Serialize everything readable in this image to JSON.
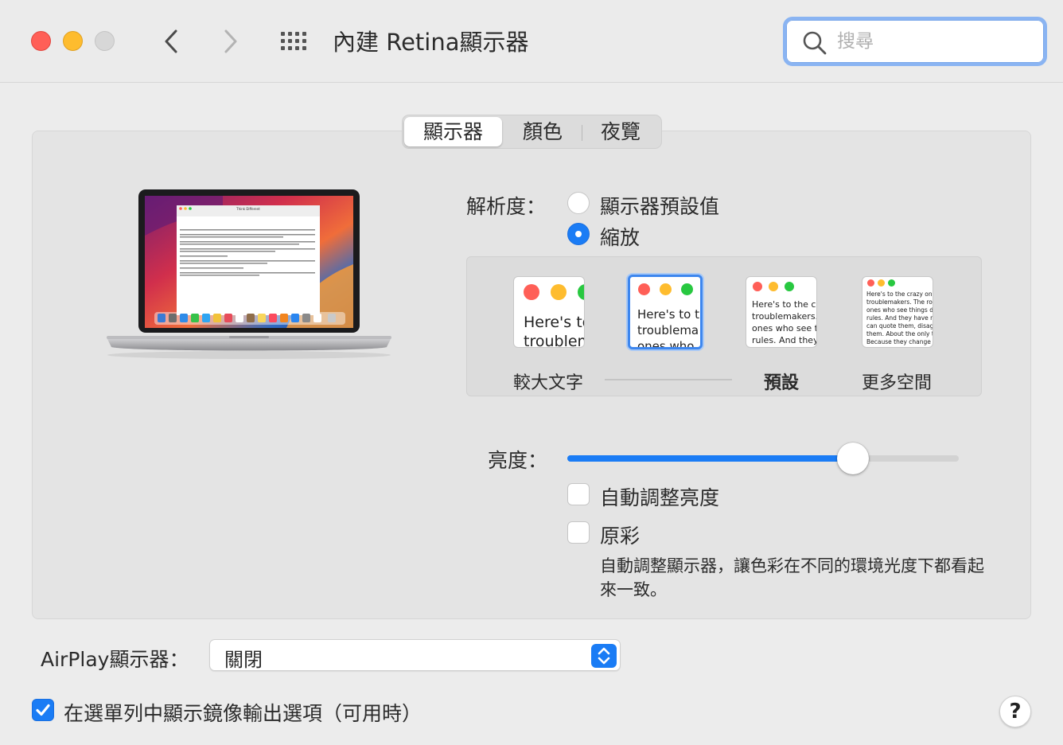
{
  "window": {
    "title": "內建 Retina顯示器",
    "search_placeholder": "搜尋"
  },
  "tabs": [
    {
      "label": "顯示器",
      "active": true
    },
    {
      "label": "顏色",
      "active": false
    },
    {
      "label": "夜覽",
      "active": false
    }
  ],
  "laptop_screen": {
    "doc_title": "Think Different",
    "doc_text": "Here's to the crazy ones. The misfits. The rebels. The troublemakers."
  },
  "resolution": {
    "label": "解析度：",
    "options": [
      {
        "label": "顯示器預設值",
        "selected": false
      },
      {
        "label": "縮放",
        "selected": true
      }
    ],
    "scale_previews": [
      {
        "text": "Here's to\ntroublem",
        "selected": false
      },
      {
        "text": "Here's to t\ntroublema\nones who",
        "selected": true
      },
      {
        "text": "Here's to the cr\ntroublemakers.\nones who see t\nrules. And they",
        "selected": false
      },
      {
        "text": "Here's to the crazy one\ntroublemakers. The rou\nones who see things dif\nrules. And they have no\ncan quote them, disagre\nthem. About the only th\nBecause they change th",
        "selected": false
      }
    ],
    "scale_labels": {
      "larger": "較大文字",
      "default": "預設",
      "more_space": "更多空間"
    }
  },
  "brightness": {
    "label": "亮度：",
    "value_fraction": 0.73,
    "auto_label": "自動調整亮度",
    "auto_checked": false,
    "true_tone_label": "原彩",
    "true_tone_checked": false,
    "true_tone_desc": "自動調整顯示器，讓色彩在不同的環境光度下都看起來一致。"
  },
  "airplay": {
    "label": "AirPlay顯示器：",
    "value": "關閉"
  },
  "mirror_option": {
    "label": "在選單列中顯示鏡像輸出選項（可用時）",
    "checked": true
  },
  "help_label": "?",
  "colors": {
    "accent": "#1a7cf5",
    "close": "#ff5f57",
    "minimize": "#febc2e"
  }
}
